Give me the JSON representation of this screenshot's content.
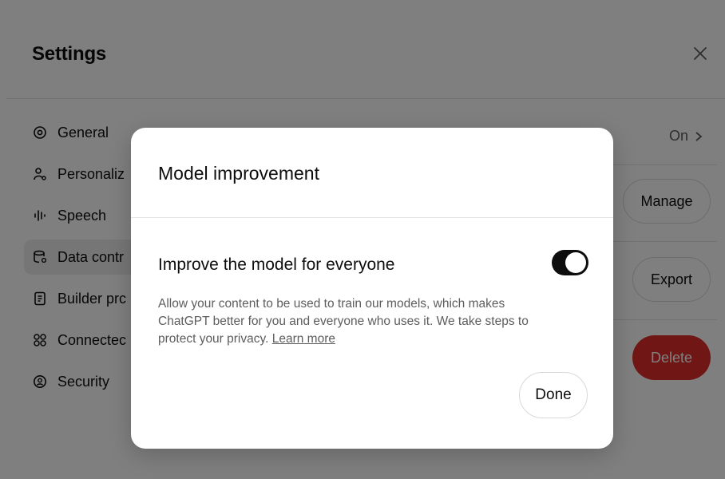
{
  "settings": {
    "title": "Settings",
    "close_icon": "close-icon",
    "sidebar": [
      {
        "label": "General",
        "icon": "gear-icon",
        "active": false
      },
      {
        "label": "Personaliz",
        "icon": "personalization-icon",
        "active": false
      },
      {
        "label": "Speech",
        "icon": "waveform-icon",
        "active": false
      },
      {
        "label": "Data contr",
        "icon": "data-controls-icon",
        "active": true
      },
      {
        "label": "Builder prc",
        "icon": "builder-profile-icon",
        "active": false
      },
      {
        "label": "Connectec",
        "icon": "connected-apps-icon",
        "active": false
      },
      {
        "label": "Security",
        "icon": "security-icon",
        "active": false
      }
    ],
    "rows": {
      "on_value": "On",
      "manage_label": "Manage",
      "export_label": "Export",
      "delete_label": "Delete"
    },
    "colors": {
      "delete": "#e02e2a",
      "toggle_on": "#0d0d0d"
    }
  },
  "modal": {
    "title": "Model improvement",
    "setting_label": "Improve the model for everyone",
    "toggle_on": true,
    "description": "Allow your content to be used to train our models, which makes ChatGPT better for you and everyone who uses it. We take steps to protect your privacy.",
    "learn_more": "Learn more",
    "done_label": "Done"
  }
}
